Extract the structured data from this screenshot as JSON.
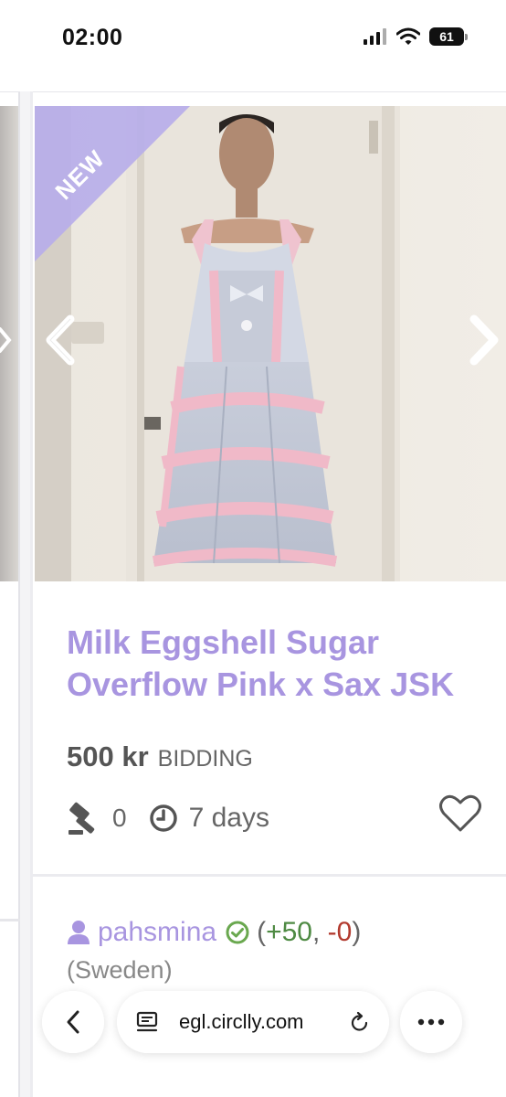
{
  "status_bar": {
    "time": "02:00",
    "battery": "61",
    "icons": [
      "signal-icon",
      "wifi-icon",
      "battery-icon"
    ]
  },
  "listing": {
    "badge": "NEW",
    "title": "Milk Eggshell Sugar Overflow Pink x Sax JSK",
    "price": "500 kr",
    "sale_type": "BIDDING",
    "bid_count": "0",
    "time_left": "7 days",
    "image_nav": [
      "chevron-left-icon",
      "chevron-right-icon"
    ],
    "favorite_icon": "heart-outline-icon"
  },
  "seller": {
    "name": "pahsmina",
    "feedback_open": "(",
    "feedback_positive": "+50",
    "feedback_sep": ", ",
    "feedback_negative": "-0",
    "feedback_close": ")",
    "location": "(Sweden)"
  },
  "browser": {
    "url": "egl.circlly.com",
    "buttons": [
      "back-icon",
      "reader-icon",
      "reload-icon",
      "more-icon"
    ]
  },
  "colors": {
    "accent": "#a895e0",
    "badge": "#b7aee9",
    "positive": "#4e8a43",
    "negative": "#b23a2e",
    "verified": "#6aa84f"
  }
}
